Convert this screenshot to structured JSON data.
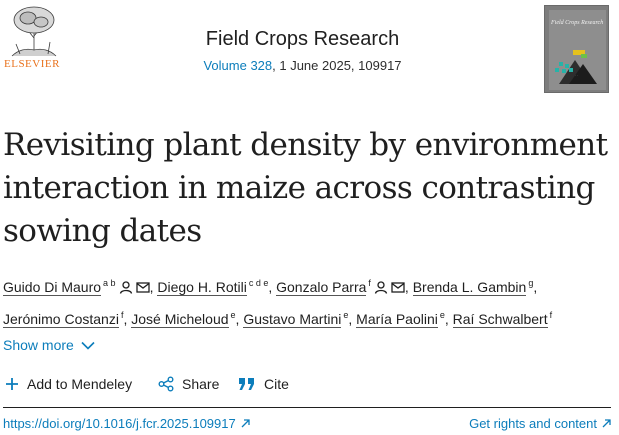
{
  "header": {
    "publisher": "ELSEVIER",
    "journal_title": "Field Crops Research",
    "volume": "Volume 328",
    "issue_rest": ", 1 June 2025, 109917",
    "cover_title": "Field Crops Research"
  },
  "article": {
    "title": "Revisiting plant density by environment interaction in maize across contrasting sowing dates"
  },
  "authors": [
    {
      "name": "Guido Di Mauro",
      "sup": "a b",
      "icons": [
        "person-icon",
        "mail-icon"
      ]
    },
    {
      "name": "Diego H. Rotili",
      "sup": "c d e",
      "icons": []
    },
    {
      "name": "Gonzalo Parra",
      "sup": "f",
      "icons": [
        "person-icon",
        "mail-icon"
      ]
    },
    {
      "name": "Brenda L. Gambin",
      "sup": "g",
      "icons": []
    },
    {
      "name": "Jerónimo Costanzi",
      "sup": "f",
      "icons": []
    },
    {
      "name": "José Micheloud",
      "sup": "e",
      "icons": []
    },
    {
      "name": "Gustavo Martini",
      "sup": "e",
      "icons": []
    },
    {
      "name": "María Paolini",
      "sup": "e",
      "icons": []
    },
    {
      "name": "Raí Schwalbert",
      "sup": "f",
      "icons": []
    }
  ],
  "show_more": "Show more",
  "actions": {
    "add_mendeley": "Add to Mendeley",
    "share": "Share",
    "cite": "Cite"
  },
  "links": {
    "doi": "https://doi.org/10.1016/j.fcr.2025.109917",
    "rights": "Get rights and content"
  },
  "colors": {
    "link": "#0c7dbb",
    "publisher": "#e9711c",
    "text": "#1f1f1f"
  }
}
